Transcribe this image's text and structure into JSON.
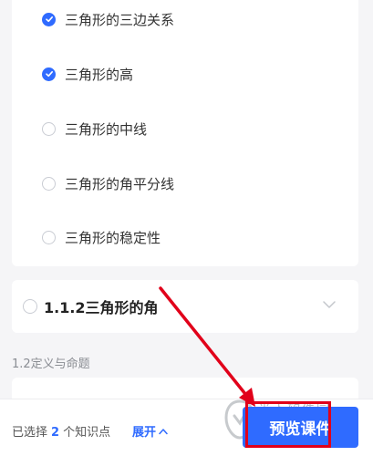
{
  "knowledge_points": [
    {
      "label": "三角形的三边关系",
      "checked": true
    },
    {
      "label": "三角形的高",
      "checked": true
    },
    {
      "label": "三角形的中线",
      "checked": false
    },
    {
      "label": "三角形的角平分线",
      "checked": false
    },
    {
      "label": "三角形的稳定性",
      "checked": false
    }
  ],
  "section": {
    "title": "1.1.2三角形的角",
    "checked": false
  },
  "subsection_label": "1.2定义与命题",
  "bottom_bar": {
    "selected_prefix": "已选择",
    "selected_count": "2",
    "selected_suffix": "个知识点",
    "expand_label": "展开",
    "preview_button": "预览课件"
  },
  "colors": {
    "accent": "#2f6bff",
    "annotation_red": "#e1001a"
  }
}
